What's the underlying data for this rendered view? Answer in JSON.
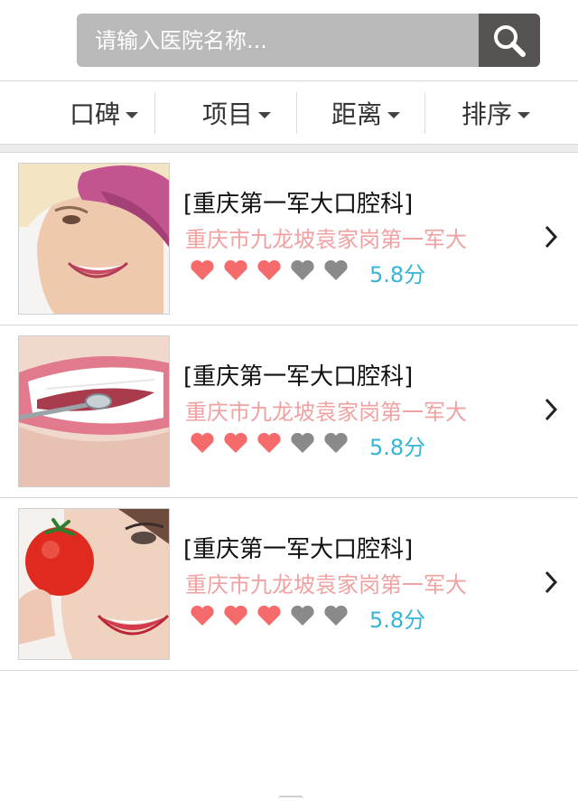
{
  "search": {
    "placeholder": "请输入医院名称..."
  },
  "filters": [
    {
      "label": "口碑"
    },
    {
      "label": "项目"
    },
    {
      "label": "距离"
    },
    {
      "label": "排序"
    }
  ],
  "colors": {
    "search_field": "#b9b9b9",
    "search_button": "#575353",
    "heart_on": "#f56a6a",
    "heart_off": "#8a8a8a",
    "address": "#f0a2a2",
    "score": "#35b6d6"
  },
  "icons": {
    "search": "magnifier-icon",
    "caret": "caret-down-icon",
    "heart": "heart-icon",
    "chevron": "chevron-right-icon"
  },
  "hospitals": [
    {
      "name": "[重庆第一军大口腔科]",
      "address": "重庆市九龙坡袁家岗第一军大",
      "rating_hearts": 3,
      "rating_max": 5,
      "score": "5.8分",
      "image": "woman-pink-hat-smile-photo"
    },
    {
      "name": "[重庆第一军大口腔科]",
      "address": "重庆市九龙坡袁家岗第一军大",
      "rating_hearts": 3,
      "rating_max": 5,
      "score": "5.8分",
      "image": "dental-mirror-teeth-photo"
    },
    {
      "name": "[重庆第一军大口腔科]",
      "address": "重庆市九龙坡袁家岗第一军大",
      "rating_hearts": 3,
      "rating_max": 5,
      "score": "5.8分",
      "image": "woman-tomato-smile-photo"
    }
  ]
}
